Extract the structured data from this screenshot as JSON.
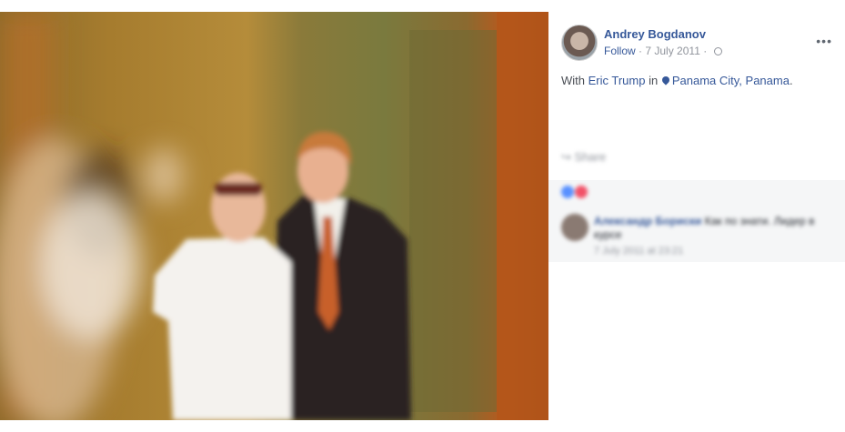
{
  "post": {
    "author": "Andrey Bogdanov",
    "follow_label": "Follow",
    "separator": "·",
    "date": "7 July 2011",
    "more_label": "•••",
    "status_prefix": "With",
    "tagged_person": "Eric Trump",
    "in_label": "in",
    "location": "Panama City, Panama",
    "status_suffix": "."
  },
  "actions": {
    "share_label": "Share"
  },
  "comment": {
    "name": "Александр Бориски",
    "text": "Как по знати. Лидер в курсе",
    "time": "7 July 2011 at 23:21"
  },
  "colors": {
    "link": "#365899",
    "meta": "#90949c",
    "reaction_like": "#5890ff",
    "reaction_love": "#f25268"
  }
}
